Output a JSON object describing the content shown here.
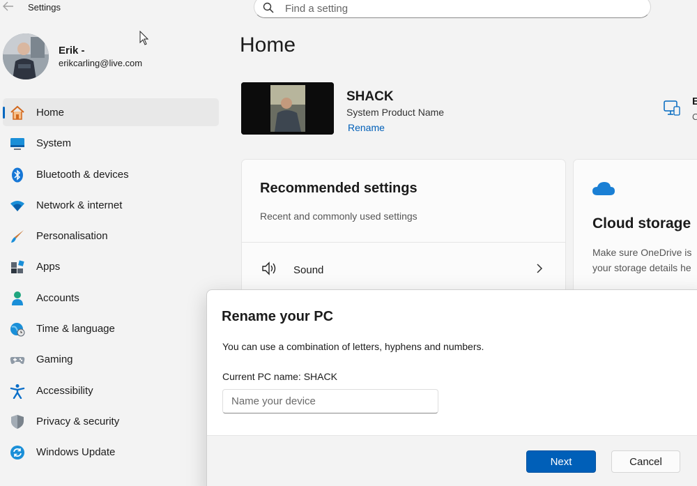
{
  "app": {
    "title": "Settings",
    "back_icon": "back-arrow-icon"
  },
  "search": {
    "placeholder": "Find a setting",
    "icon": "search-icon"
  },
  "user": {
    "name": "Erik -",
    "email": "erikcarling@live.com"
  },
  "sidebar": {
    "items": [
      {
        "label": "Home",
        "icon": "home-icon",
        "active": true
      },
      {
        "label": "System",
        "icon": "system-icon"
      },
      {
        "label": "Bluetooth & devices",
        "icon": "bluetooth-icon"
      },
      {
        "label": "Network & internet",
        "icon": "wifi-icon"
      },
      {
        "label": "Personalisation",
        "icon": "brush-icon"
      },
      {
        "label": "Apps",
        "icon": "apps-icon"
      },
      {
        "label": "Accounts",
        "icon": "accounts-icon"
      },
      {
        "label": "Time & language",
        "icon": "globe-clock-icon"
      },
      {
        "label": "Gaming",
        "icon": "gamepad-icon"
      },
      {
        "label": "Accessibility",
        "icon": "accessibility-icon"
      },
      {
        "label": "Privacy & security",
        "icon": "shield-icon"
      },
      {
        "label": "Windows Update",
        "icon": "update-icon"
      }
    ]
  },
  "main": {
    "title": "Home",
    "pc": {
      "name": "SHACK",
      "model": "System Product Name",
      "rename_label": "Rename"
    },
    "right_partial": {
      "line1": "E",
      "line2": "C"
    },
    "recommended": {
      "title": "Recommended settings",
      "subtitle": "Recent and commonly used settings",
      "items": [
        {
          "label": "Sound",
          "icon": "speaker-icon"
        }
      ]
    },
    "cloud": {
      "title": "Cloud storage",
      "desc_line1": "Make sure OneDrive is",
      "desc_line2": "your storage details he"
    }
  },
  "dialog": {
    "title": "Rename your PC",
    "description": "You can use a combination of letters, hyphens and numbers.",
    "current_name": "Current PC name: SHACK",
    "input_placeholder": "Name your device",
    "input_value": "",
    "next_label": "Next",
    "cancel_label": "Cancel"
  },
  "colors": {
    "accent": "#005fb8",
    "active_indicator": "#0067c0",
    "background": "#f3f3f3"
  }
}
